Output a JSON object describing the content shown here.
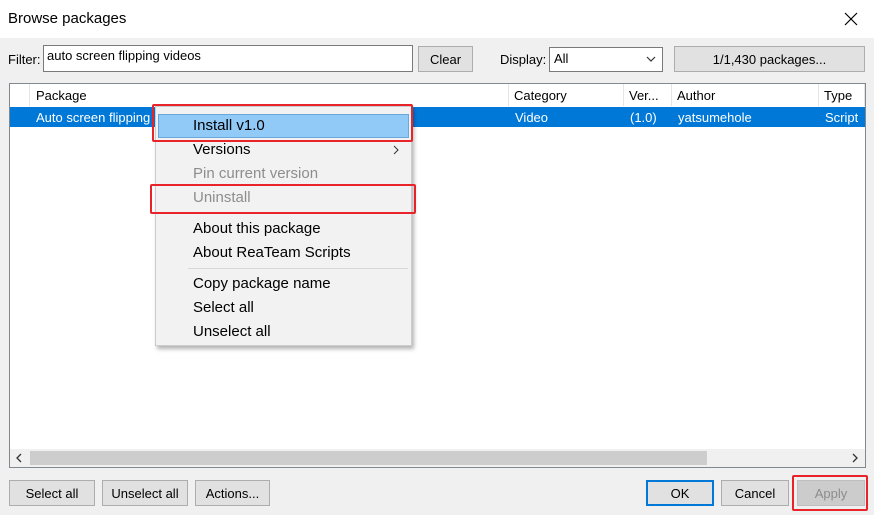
{
  "window": {
    "title": "Browse packages",
    "close_icon": "close-icon"
  },
  "filter": {
    "label": "Filter:",
    "value": "auto screen flipping videos",
    "clear_label": "Clear"
  },
  "display": {
    "label": "Display:",
    "selected": "All",
    "count_label": "1/1,430 packages..."
  },
  "table": {
    "columns": [
      "Package",
      "Category",
      "Ver...",
      "Author",
      "Type"
    ],
    "rows": [
      {
        "package": "Auto screen flipping",
        "category": "Video",
        "version": "(1.0)",
        "author": "yatsumehole",
        "type": "Script"
      }
    ]
  },
  "context_menu": {
    "install": "Install v1.0",
    "versions": "Versions",
    "pin": "Pin current version",
    "uninstall": "Uninstall",
    "about_package": "About this package",
    "about_repo": "About ReaTeam Scripts",
    "copy_name": "Copy package name",
    "select_all": "Select all",
    "unselect_all": "Unselect all"
  },
  "footer": {
    "select_all": "Select all",
    "unselect_all": "Unselect all",
    "actions": "Actions...",
    "ok": "OK",
    "cancel": "Cancel",
    "apply": "Apply"
  },
  "colors": {
    "selection": "#0078d7",
    "highlight": "#91c9f7",
    "annotation": "#e8242a"
  }
}
